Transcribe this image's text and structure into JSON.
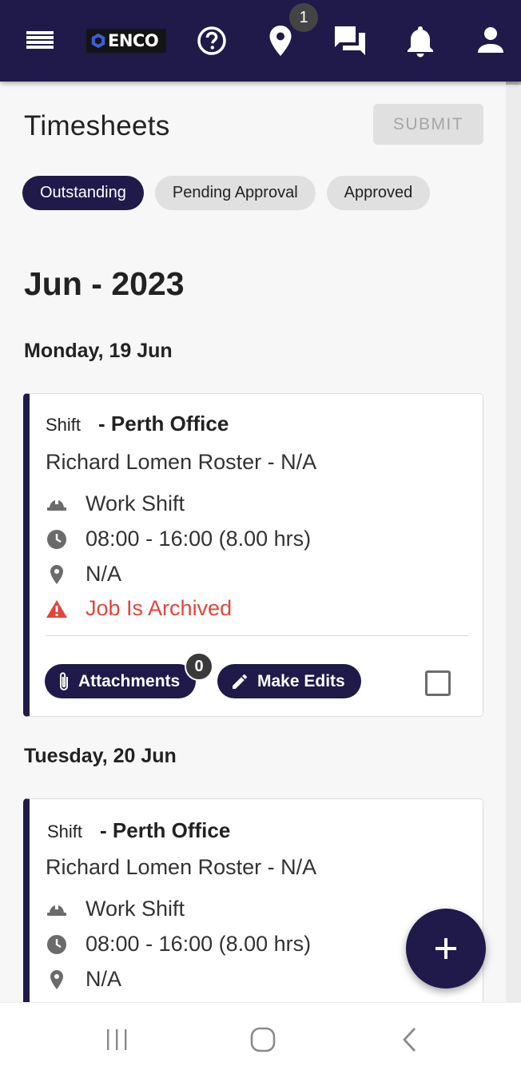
{
  "header": {
    "logo_text": "ENCO",
    "location_badge": "1",
    "icons": [
      "menu-icon",
      "help-icon",
      "location-pin-icon",
      "chat-icon",
      "bell-icon",
      "user-icon"
    ]
  },
  "page": {
    "title": "Timesheets",
    "submit_label": "SUBMIT"
  },
  "tabs": [
    {
      "label": "Outstanding",
      "active": true
    },
    {
      "label": "Pending Approval",
      "active": false
    },
    {
      "label": "Approved",
      "active": false
    }
  ],
  "month": "Jun - 2023",
  "entries": [
    {
      "day": "Monday, 19 Jun",
      "shift_label": "Shift",
      "location": "- Perth Office",
      "roster": "Richard Lomen Roster - N/A",
      "type": "Work Shift",
      "time": "08:00 - 16:00 (8.00 hrs)",
      "place": "N/A",
      "warning": "Job Is Archived",
      "attachments_label": "Attachments",
      "attachments_count": "0",
      "edit_label": "Make Edits"
    },
    {
      "day": "Tuesday, 20 Jun",
      "shift_label": "Shift",
      "location": "- Perth Office",
      "roster": "Richard Lomen Roster - N/A",
      "type": "Work Shift",
      "time": "08:00 - 16:00 (8.00 hrs)",
      "place": "N/A"
    }
  ],
  "colors": {
    "primary": "#1f1a4a",
    "warning": "#e0463e",
    "chip_inactive": "#e0e0e0"
  }
}
